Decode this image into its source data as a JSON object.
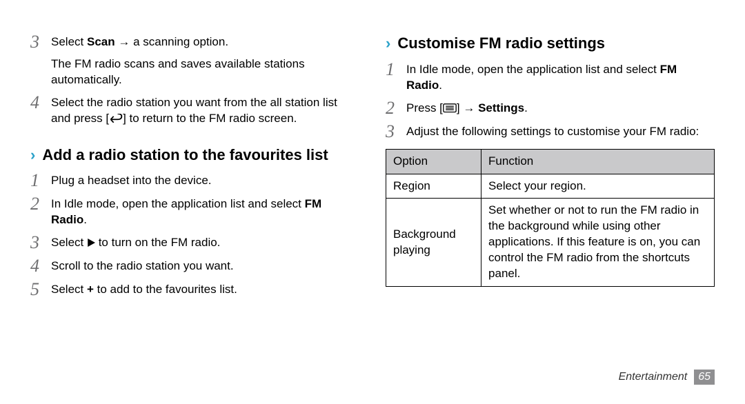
{
  "left": {
    "step3": {
      "num": "3",
      "pre": "Select ",
      "scan": "Scan",
      "mid": " → a scanning option.",
      "sub": "The FM radio scans and saves available stations automatically."
    },
    "step4": {
      "num": "4",
      "pre": "Select the radio station you want from the all station list and press [",
      "post": "] to return to the FM radio screen."
    },
    "headingA": "Add a radio station to the favourites list",
    "a1": {
      "num": "1",
      "text": "Plug a headset into the device."
    },
    "a2": {
      "num": "2",
      "pre": "In Idle mode, open the application list and select ",
      "fm": "FM Radio",
      "post": "."
    },
    "a3": {
      "num": "3",
      "pre": "Select ",
      "post": " to turn on the FM radio."
    },
    "a4": {
      "num": "4",
      "text": "Scroll to the radio station you want."
    },
    "a5": {
      "num": "5",
      "pre": "Select ",
      "plus": "+",
      "post": " to add to the favourites list."
    }
  },
  "right": {
    "headingB": "Customise FM radio settings",
    "b1": {
      "num": "1",
      "pre": "In Idle mode, open the application list and select ",
      "fm": "FM Radio",
      "post": "."
    },
    "b2": {
      "num": "2",
      "pre": "Press [",
      "mid": "] → ",
      "settings": "Settings",
      "post": "."
    },
    "b3": {
      "num": "3",
      "text": "Adjust the following settings to customise your FM radio:"
    },
    "table": {
      "head": {
        "option": "Option",
        "function": "Function"
      },
      "row1": {
        "option": "Region",
        "function": "Select your region."
      },
      "row2": {
        "option": "Background playing",
        "function": "Set whether or not to run the FM radio in the background while using other applications. If this feature is on, you can control the FM radio from the shortcuts panel."
      }
    }
  },
  "footer": {
    "section": "Entertainment",
    "page": "65"
  }
}
